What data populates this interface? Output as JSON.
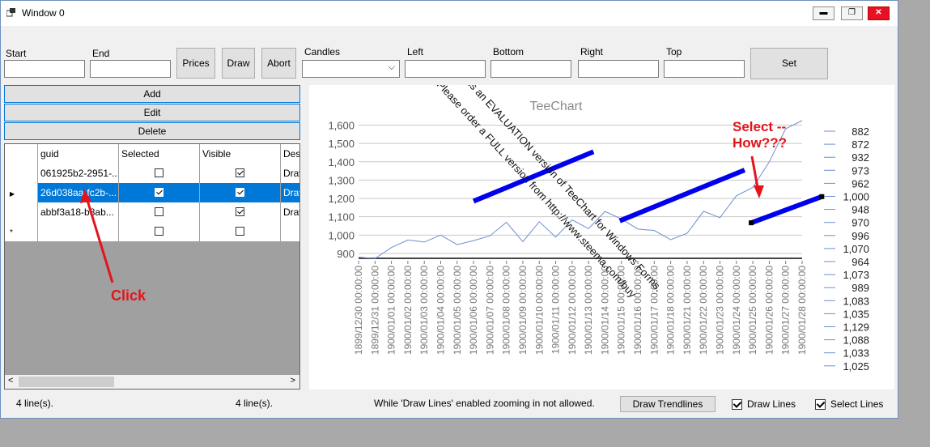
{
  "window": {
    "title": "Window 0",
    "minimize": "▬",
    "maximize": "❐",
    "close": "✕"
  },
  "toolbar": {
    "start_label": "Start",
    "start_value": "",
    "end_label": "End",
    "end_value": "",
    "prices": "Prices",
    "draw": "Draw",
    "abort": "Abort",
    "candles_label": "Candles",
    "candles_value": "",
    "left_label": "Left",
    "bottom_label": "Bottom",
    "right_label": "Right",
    "top_label": "Top",
    "set": "Set"
  },
  "buttons": {
    "add": "Add",
    "edit": "Edit",
    "delete": "Delete"
  },
  "grid": {
    "columns": [
      "guid",
      "Selected",
      "Visible",
      "Des"
    ],
    "rows": [
      {
        "guid": "061925b2-2951-...",
        "selected": false,
        "visible": true,
        "des": "Draw"
      },
      {
        "guid": "26d038aa-fc2b-...",
        "selected": true,
        "visible": true,
        "des": "Draw"
      },
      {
        "guid": "abbf3a18-b8ab...",
        "selected": false,
        "visible": true,
        "des": "Draw"
      }
    ],
    "new_row_marker": "*",
    "current_row_marker": "▶"
  },
  "status": {
    "left_count": "4 line(s).",
    "mid_count": "4 line(s).",
    "message": "While 'Draw Lines' enabled zooming in not allowed.",
    "draw_trendlines": "Draw Trendlines",
    "draw_lines": "Draw Lines",
    "select_lines": "Select Lines"
  },
  "annotations": {
    "click": "Click",
    "select_line1": "Select --",
    "select_line2": "How???"
  },
  "colors": {
    "selection": "#0078d7",
    "trendline": "#0000ee",
    "annotation": "#e3141b",
    "series": "#6c8fcf"
  },
  "chart_data": {
    "type": "line",
    "title": "TeeChart",
    "watermark_line1": "is an EVALUATION version of TeeChart for Windows Forms.",
    "watermark_line2": "Please order a FULL version from http://www.steema.com/buy",
    "x": [
      "1899/12/30 00:00:00",
      "1899/12/31 00:00:00",
      "1900/01/01 00:00:00",
      "1900/01/02 00:00:00",
      "1900/01/03 00:00:00",
      "1900/01/04 00:00:00",
      "1900/01/05 00:00:00",
      "1900/01/06 00:00:00",
      "1900/01/07 00:00:00",
      "1900/01/08 00:00:00",
      "1900/01/09 00:00:00",
      "1900/01/10 00:00:00",
      "1900/01/11 00:00:00",
      "1900/01/12 00:00:00",
      "1900/01/13 00:00:00",
      "1900/01/14 00:00:00",
      "1900/01/15 00:00:00",
      "1900/01/16 00:00:00",
      "1900/01/17 00:00:00",
      "1900/01/18 00:00:00",
      "1900/01/21 00:00:00",
      "1900/01/22 00:00:00",
      "1900/01/23 00:00:00",
      "1900/01/24 00:00:00",
      "1900/01/25 00:00:00",
      "1900/01/26 00:00:00",
      "1900/01/27 00:00:00",
      "1900/01/28 00:00:00"
    ],
    "yticks": [
      900,
      1000,
      1100,
      1200,
      1300,
      1400,
      1500,
      1600
    ],
    "ytick_labels": [
      "900",
      "1,000",
      "1,100",
      "1,200",
      "1,300",
      "1,400",
      "1,500",
      "1,600"
    ],
    "ylim": [
      860,
      1620
    ],
    "legend": [
      "882",
      "872",
      "932",
      "973",
      "962",
      "1,000",
      "948",
      "970",
      "996",
      "1,070",
      "964",
      "1,073",
      "989",
      "1,083",
      "1,035",
      "1,129",
      "1,088",
      "1,033",
      "1,025"
    ],
    "legend_placement": "right",
    "grid": true,
    "series": [
      {
        "values": [
          880,
          872,
          932,
          973,
          962,
          1000,
          948,
          970,
          996,
          1070,
          964,
          1073,
          989,
          1083,
          1035,
          1129,
          1088,
          1033,
          1025,
          975,
          1010,
          1130,
          1095,
          1215,
          1260,
          1400,
          1580,
          1625
        ]
      }
    ],
    "trendlines": [
      {
        "x": [
          7.0,
          14.3
        ],
        "y": [
          1185,
          1455
        ]
      },
      {
        "x": [
          15.9,
          23.5
        ],
        "y": [
          1078,
          1355
        ]
      },
      {
        "x": [
          23.9,
          28.2
        ],
        "y": [
          1067,
          1210
        ]
      }
    ]
  }
}
